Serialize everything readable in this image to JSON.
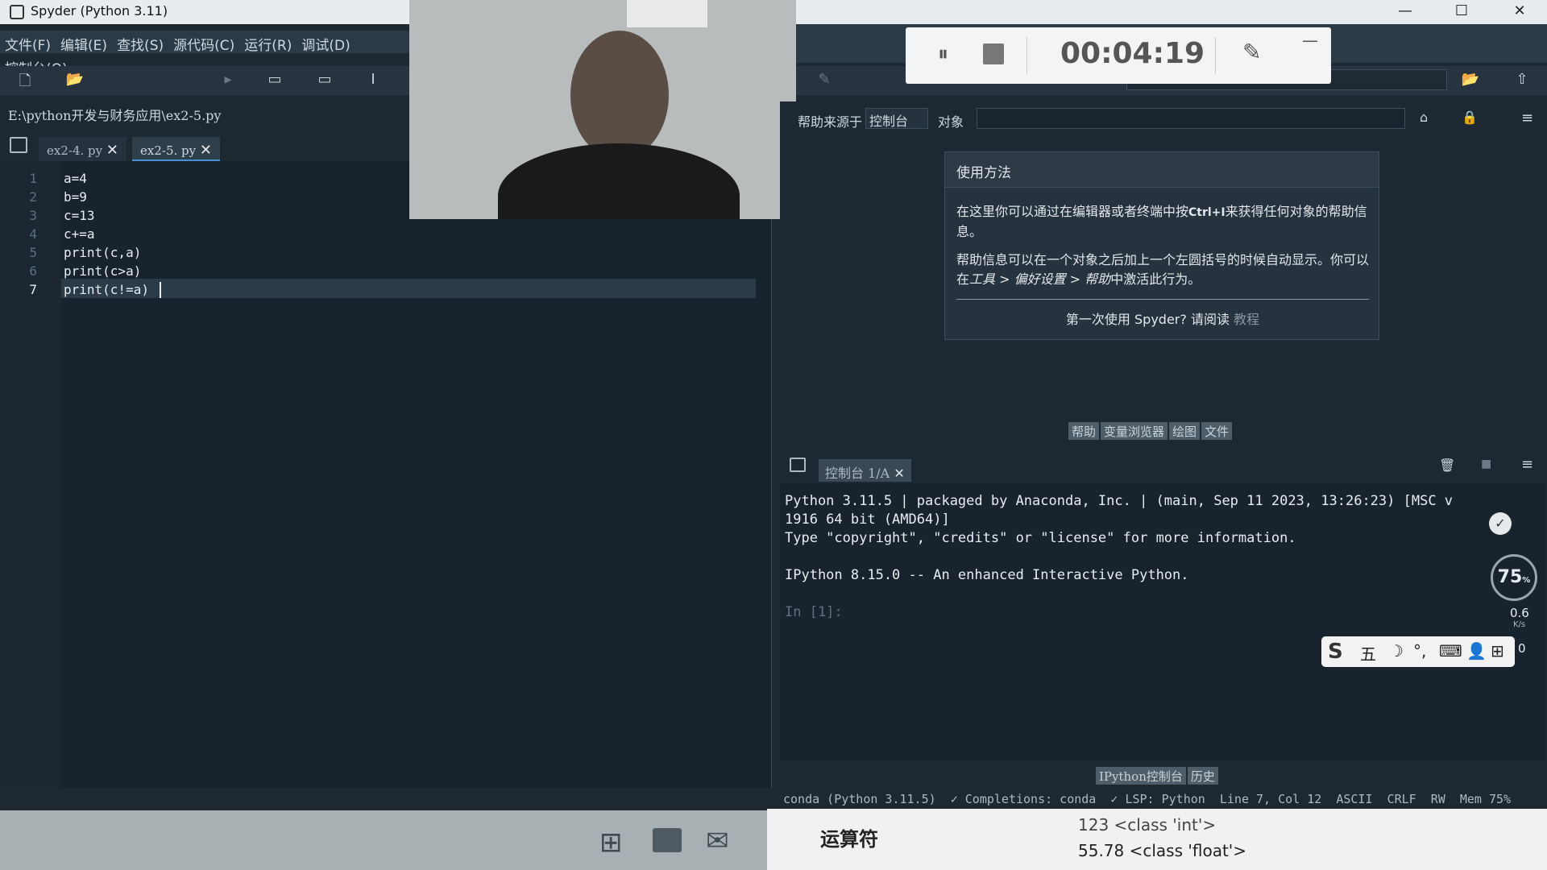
{
  "window": {
    "title": "Spyder (Python 3.11)",
    "minimize": "—",
    "maximize": "☐",
    "close": "✕"
  },
  "menu": [
    "文件(F)",
    "编辑(E)",
    "查找(S)",
    "源代码(C)",
    "运行(R)",
    "调试(D)",
    "控制台(O)"
  ],
  "path": "E:\\python开发与财务应用\\ex2-5.py",
  "editor_tabs": [
    {
      "label": "ex2-4. py"
    },
    {
      "label": "ex2-5. py"
    }
  ],
  "code_lines": [
    "a=4",
    "b=9",
    "c=13",
    "c+=a",
    "print(c,a)",
    "print(c>a)",
    "print(c!=a)"
  ],
  "line_numbers": [
    "1",
    "2",
    "3",
    "4",
    "5",
    "6",
    "7"
  ],
  "help_panel": {
    "source_label": "帮助来源于",
    "source_value": "控制台",
    "object_label": "对象",
    "usage_title": "使用方法",
    "usage_p1_a": "在这里你可以通过在编辑器或者终端中按",
    "usage_p1_key": "Ctrl+I",
    "usage_p1_b": "来获得任何对象的帮助信息。",
    "usage_p2_a": "帮助信息可以在一个对象之后加上一个左圆括号的时候自动显示。你可以在",
    "usage_p2_menu": "工具 > 偏好设置 > 帮助",
    "usage_p2_b": "中激活此行为。",
    "first_time": "第一次使用 Spyder? 请阅读",
    "tutorial_link": "教程"
  },
  "middle_tabs": [
    "帮助",
    "变量浏览器",
    "绘图",
    "文件"
  ],
  "console_tab": "控制台 1/A",
  "console_lines": [
    "Python 3.11.5 | packaged by Anaconda, Inc. | (main, Sep 11 2023, 13:26:23) [MSC v",
    "1916 64 bit (AMD64)]",
    "Type \"copyright\", \"credits\" or \"license\" for more information.",
    "",
    "IPython 8.15.0 -- An enhanced Interactive Python.",
    "",
    "In [1]:"
  ],
  "bottom_tabs": [
    "IPython控制台",
    "历史"
  ],
  "status": "conda (Python 3.11.5)  ✓ Completions: conda  ✓ LSP: Python  Line 7, Col 12  ASCII  CRLF  RW  Mem 75%",
  "recorder": {
    "time": "00:04:19",
    "minimize": "—"
  },
  "gauge": {
    "value": "75",
    "unit": "%",
    "net_up": "0.6",
    "net_unit": "K/s",
    "net_down": "0"
  },
  "ime": {
    "glyph": "五"
  },
  "overlay": {
    "title": "运算符",
    "line1": "123 <class 'int'>",
    "line2": "55.78 <class 'float'>"
  }
}
